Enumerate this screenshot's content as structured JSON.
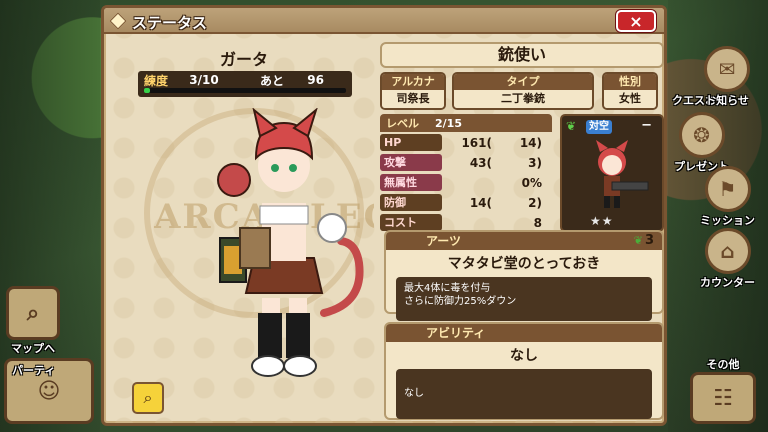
{
  "sidebar_left": {
    "map_label": "マップへ",
    "party_label": "パーティ"
  },
  "sidebar_right": {
    "notice_label": "お知らせ",
    "quest_label": "クエスト",
    "present_label": "プレゼント",
    "mission_label": "ミッション",
    "counter_label": "カウンター",
    "other_label": "その他"
  },
  "header": {
    "title": "ステータス",
    "close_icon": "×"
  },
  "character": {
    "name": "ガータ",
    "training_label": "練度",
    "training_value": "3/10",
    "remaining_label": "あと",
    "remaining_value": "96",
    "training_progress": 0.03,
    "emblem_text": "ARCAL LEGEND"
  },
  "zoom_icon": "zoom-icon",
  "info": {
    "class_name": "銃使い",
    "arcana_label": "アルカナ",
    "arcana_value": "司祭長",
    "type_label": "タイプ",
    "type_value": "二丁拳銃",
    "gender_label": "性別",
    "gender_value": "女性",
    "level_label": "レベル",
    "level_value": "2/15",
    "stats": [
      {
        "label": "HP",
        "value": "161(",
        "bonus": "14)"
      },
      {
        "label": "攻撃",
        "value": "43(",
        "bonus": "3)"
      },
      {
        "label": "無属性",
        "value": "",
        "bonus": "0%"
      },
      {
        "label": "防御",
        "value": "14(",
        "bonus": "2)"
      },
      {
        "label": "コスト",
        "value": "",
        "bonus": "8"
      }
    ],
    "anti_air_label": "対空",
    "portrait_dash": "−",
    "stars": "★★"
  },
  "arts": {
    "heading": "アーツ",
    "cost": "3",
    "name": "マタタビ堂のとっておき",
    "desc_line1": "最大4体に毒を付与",
    "desc_line2": "さらに防御力25%ダウン"
  },
  "ability": {
    "heading": "アビリティ",
    "name": "なし",
    "desc": "なし"
  },
  "colors": {
    "panel": "#e9dcbf",
    "frame": "#7a5532",
    "close": "#c8262a",
    "exp_fill": "#38d14a"
  }
}
